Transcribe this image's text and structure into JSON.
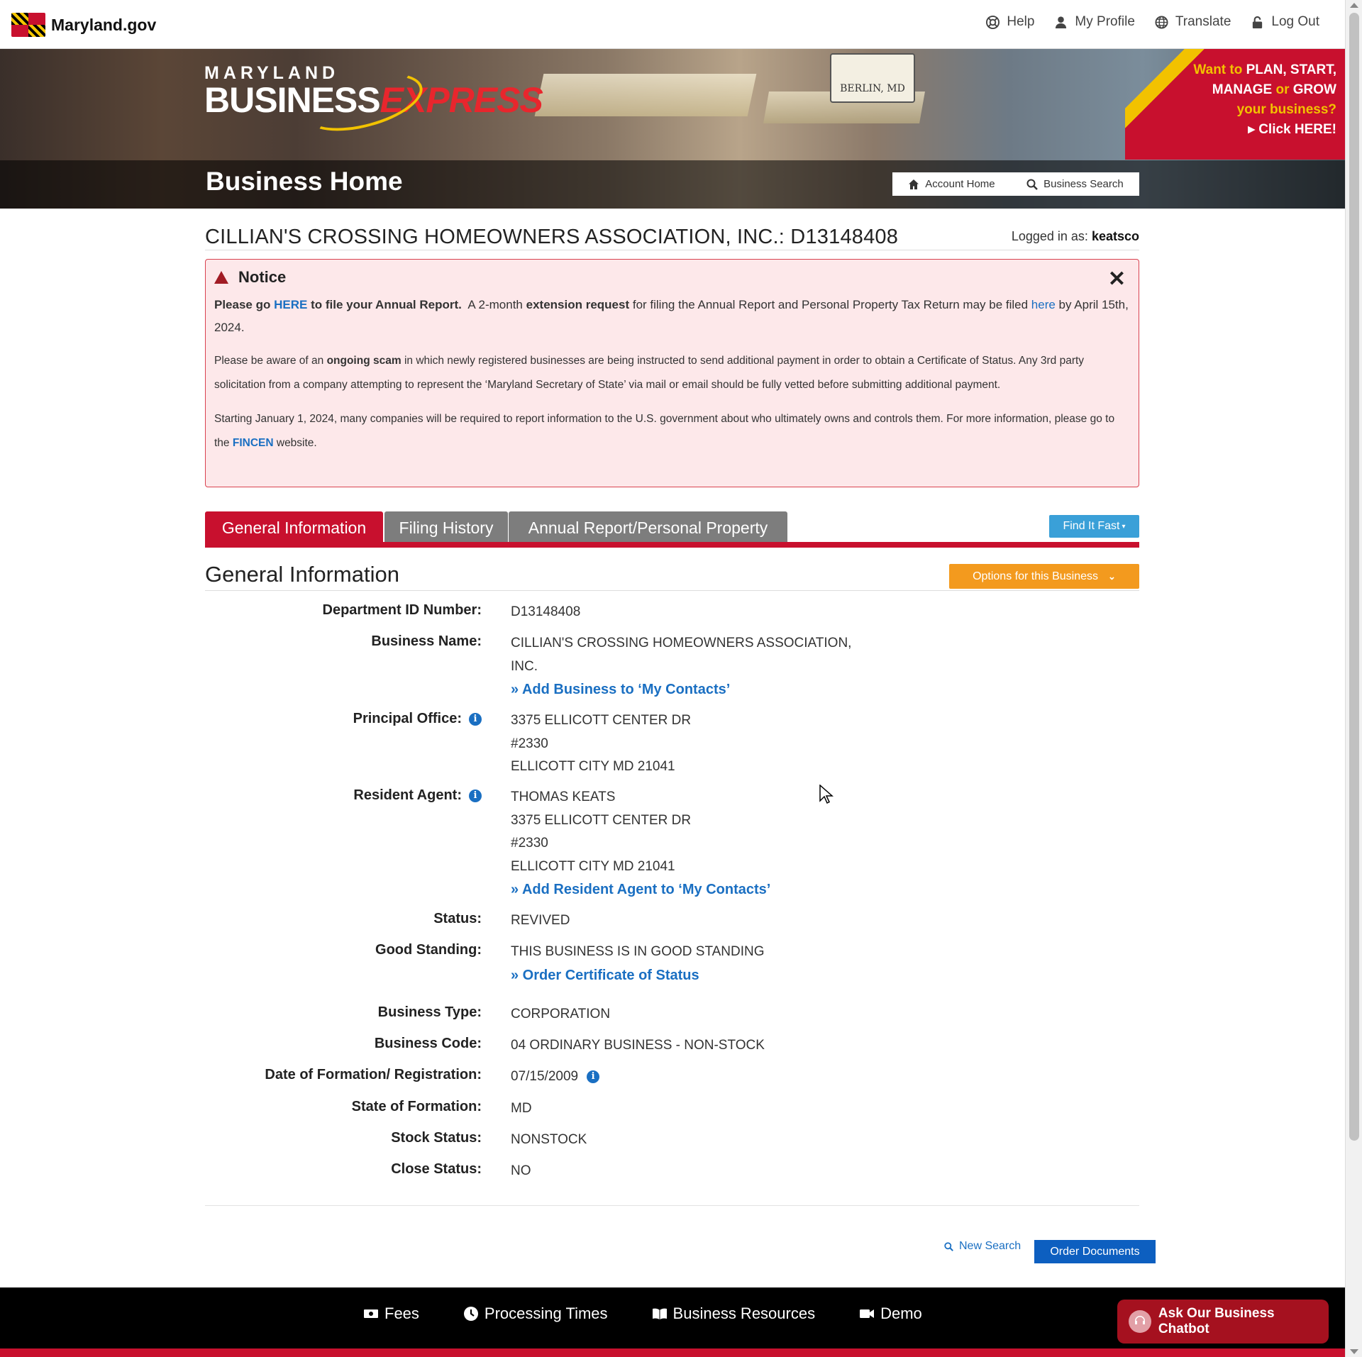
{
  "topbar": {
    "brand": "Maryland.gov",
    "nav": [
      {
        "label": "Help",
        "icon": "lifebuoy-icon"
      },
      {
        "label": "My Profile",
        "icon": "user-icon"
      },
      {
        "label": "Translate",
        "icon": "globe-icon"
      },
      {
        "label": "Log Out",
        "icon": "unlock-icon"
      }
    ]
  },
  "banner": {
    "logo_top": "MARYLAND",
    "logo_main": "BUSINESS",
    "logo_accent": "EXPRESS",
    "heading": "Business Home",
    "sign_text": "BERLIN, MD",
    "quicklinks": [
      {
        "label": "Account Home",
        "icon": "home-icon"
      },
      {
        "label": "Business Search",
        "icon": "search-icon"
      }
    ],
    "promo": {
      "line1_a": "Want to ",
      "line1_b": "PLAN, START,",
      "line2_a": "MANAGE",
      "line2_b": " or ",
      "line2_c": "GROW",
      "line3": "your business?",
      "line4": "Click HERE!"
    }
  },
  "business": {
    "title": "CILLIAN'S CROSSING HOMEOWNERS ASSOCIATION, INC.: D13148408",
    "logged_in_label": "Logged in as:",
    "logged_in_user": "keatsco"
  },
  "notice": {
    "heading": "Notice",
    "p1_a": "Please go ",
    "p1_link": "HERE",
    "p1_b": " to file your Annual Report.",
    "p1_c": "  A 2-month ",
    "p1_d": "extension request",
    "p1_e": " for filing the Annual Report and Personal Property Tax Return may be filed ",
    "p1_link2": "here",
    "p1_f": " by April 15th, 2024.",
    "p2_a": "Please be aware of an ",
    "p2_b": "ongoing scam",
    "p2_c": " in which newly registered businesses are being instructed to send additional payment in order to obtain a Certificate of Status. Any 3rd party solicitation from a company attempting to represent the ‘Maryland Secretary of State’ via mail or email should be fully vetted before submitting additional payment.",
    "p3_a": "Starting January 1, 2024, many companies will be required to report information to the U.S. government about who ultimately owns and controls them. For more information, please go to the ",
    "p3_link": "FINCEN",
    "p3_b": " website."
  },
  "tabs": [
    {
      "label": "General Information",
      "active": true
    },
    {
      "label": "Filing History",
      "active": false
    },
    {
      "label": "Annual Report/Personal Property",
      "active": false
    }
  ],
  "find_it_fast": "Find It Fast",
  "general": {
    "heading": "General Information",
    "options_label": "Options for this Business",
    "fields": {
      "dept_id": {
        "label": "Department ID Number:",
        "value": "D13148408"
      },
      "business_name": {
        "label": "Business Name:",
        "value": "CILLIAN'S CROSSING HOMEOWNERS ASSOCIATION, INC.",
        "link": "» Add Business to ‘My Contacts’"
      },
      "principal_office": {
        "label": "Principal Office:",
        "lines": [
          "3375 ELLICOTT CENTER DR",
          "#2330",
          "ELLICOTT CITY MD 21041"
        ]
      },
      "resident_agent": {
        "label": "Resident Agent:",
        "lines": [
          "THOMAS KEATS",
          "3375 ELLICOTT CENTER DR",
          "#2330",
          "ELLICOTT CITY MD 21041"
        ],
        "link": "» Add Resident Agent to ‘My Contacts’"
      },
      "status": {
        "label": "Status:",
        "value": "REVIVED"
      },
      "good_standing": {
        "label": "Good Standing:",
        "value": "THIS BUSINESS IS IN GOOD STANDING",
        "link": "» Order Certificate of Status"
      },
      "business_type": {
        "label": "Business Type:",
        "value": "CORPORATION"
      },
      "business_code": {
        "label": "Business Code:",
        "value": "04 ORDINARY BUSINESS - NON-STOCK"
      },
      "date_formation": {
        "label": "Date of Formation/ Registration:",
        "value": "07/15/2009"
      },
      "state_formation": {
        "label": "State of Formation:",
        "value": "MD"
      },
      "stock_status": {
        "label": "Stock Status:",
        "value": "NONSTOCK"
      },
      "close_status": {
        "label": "Close Status:",
        "value": "NO"
      }
    }
  },
  "actions": {
    "new_search": "New Search",
    "order_documents": "Order Documents"
  },
  "footer": {
    "links": [
      {
        "label": "Fees",
        "icon": "money-icon"
      },
      {
        "label": "Processing Times",
        "icon": "clock-icon"
      },
      {
        "label": "Business Resources",
        "icon": "book-icon"
      },
      {
        "label": "Demo",
        "icon": "video-icon"
      }
    ],
    "chatbot": "Ask Our Business Chatbot"
  },
  "colors": {
    "brand_red": "#c8102e",
    "link_blue": "#1a6fc2",
    "options_orange": "#f39a1e",
    "find_fast_blue": "#3aa0d8",
    "tab_gray": "#7d7d7d"
  }
}
